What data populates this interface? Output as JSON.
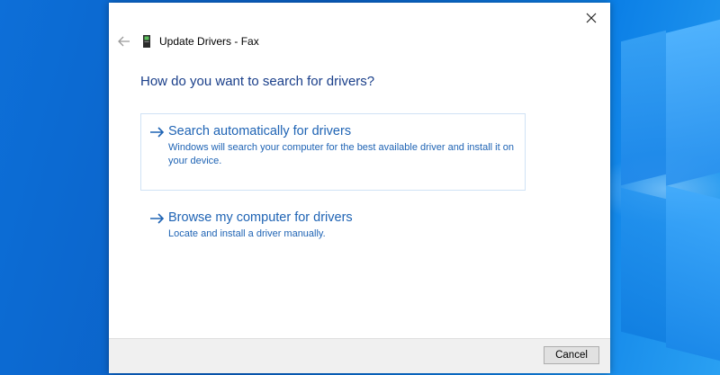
{
  "window": {
    "title": "Update Drivers - Fax",
    "back_icon": "back-arrow-icon",
    "device_icon": "device-icon",
    "close_icon": "close-icon"
  },
  "heading": "How do you want to search for drivers?",
  "options": [
    {
      "title": "Search automatically for drivers",
      "description": "Windows will search your computer for the best available driver and install it on your device.",
      "icon": "arrow-right-icon"
    },
    {
      "title": "Browse my computer for drivers",
      "description": "Locate and install a driver manually.",
      "icon": "arrow-right-icon"
    }
  ],
  "footer": {
    "cancel_label": "Cancel"
  },
  "colors": {
    "link": "#1e63b4",
    "heading": "#1a3f8a",
    "desktop": "#0a63c9"
  }
}
